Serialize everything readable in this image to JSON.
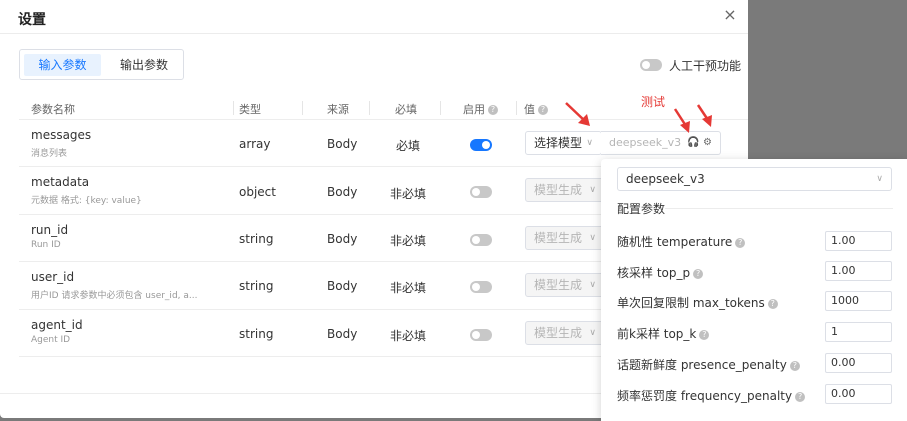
{
  "dialog": {
    "title": "设置",
    "close_icon": "×"
  },
  "tabs": {
    "input": "输入参数",
    "output": "输出参数"
  },
  "hitl": {
    "label": "人工干预功能",
    "on": false
  },
  "headers": {
    "name": "参数名称",
    "type": "类型",
    "source": "来源",
    "required": "必填",
    "enabled": "启用",
    "value": "值",
    "help": "?"
  },
  "rows": [
    {
      "name": "messages",
      "desc": "消息列表",
      "type": "array",
      "source": "Body",
      "required": "必填",
      "enabled": true,
      "select": "选择模型",
      "chev": "∨"
    },
    {
      "name": "metadata",
      "desc": "元数据 格式: {key: value}",
      "type": "object",
      "source": "Body",
      "required": "非必填",
      "enabled": false,
      "select": "模型生成",
      "chev": "∨"
    },
    {
      "name": "run_id",
      "desc": "Run ID",
      "type": "string",
      "source": "Body",
      "required": "非必填",
      "enabled": false,
      "select": "模型生成",
      "chev": "∨"
    },
    {
      "name": "user_id",
      "desc": "用户ID 请求参数中必须包含 user_id, a...",
      "type": "string",
      "source": "Body",
      "required": "非必填",
      "enabled": false,
      "select": "模型生成",
      "chev": "∨"
    },
    {
      "name": "agent_id",
      "desc": "Agent ID",
      "type": "string",
      "source": "Body",
      "required": "非必填",
      "enabled": false,
      "select": "模型生成",
      "chev": "∨"
    }
  ],
  "model_input": {
    "placeholder": "deepseek_v3"
  },
  "annotation": {
    "text": "测试",
    "color": "#e53935"
  },
  "icons": {
    "headset": "🎧",
    "gear": "⚙"
  },
  "popover": {
    "model": "deepseek_v3",
    "chev": "∨",
    "section": "配置参数",
    "params": [
      {
        "label": "随机性 temperature",
        "value": "1.00"
      },
      {
        "label": "核采样 top_p",
        "value": "1.00"
      },
      {
        "label": "单次回复限制 max_tokens",
        "value": "1000"
      },
      {
        "label": "前k采样 top_k",
        "value": "1"
      },
      {
        "label": "话题新鲜度 presence_penalty",
        "value": "0.00"
      },
      {
        "label": "频率惩罚度 frequency_penalty",
        "value": "0.00"
      }
    ]
  },
  "colors": {
    "accent": "#1677ff",
    "overlay": "#7a7a7a"
  }
}
